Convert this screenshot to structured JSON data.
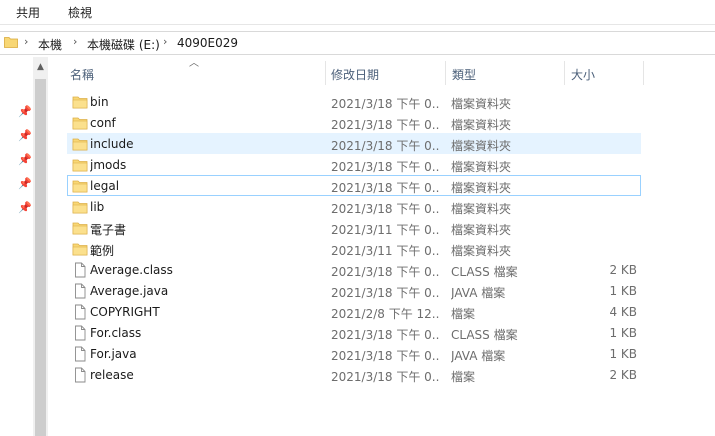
{
  "ribbon": {
    "tabs": [
      "共用",
      "檢視"
    ]
  },
  "address": {
    "crumbs": [
      "本機",
      "本機磁碟 (E:)",
      "4090E029"
    ]
  },
  "columns": {
    "name": "名稱",
    "date": "修改日期",
    "type": "類型",
    "size": "大小"
  },
  "files": [
    {
      "name": "bin",
      "date": "2021/3/18 下午 0...",
      "type": "檔案資料夾",
      "size": "",
      "icon": "folder-icon"
    },
    {
      "name": "conf",
      "date": "2021/3/18 下午 0...",
      "type": "檔案資料夾",
      "size": "",
      "icon": "folder-icon"
    },
    {
      "name": "include",
      "date": "2021/3/18 下午 0...",
      "type": "檔案資料夾",
      "size": "",
      "icon": "folder-icon"
    },
    {
      "name": "jmods",
      "date": "2021/3/18 下午 0...",
      "type": "檔案資料夾",
      "size": "",
      "icon": "folder-icon"
    },
    {
      "name": "legal",
      "date": "2021/3/18 下午 0...",
      "type": "檔案資料夾",
      "size": "",
      "icon": "folder-icon"
    },
    {
      "name": "lib",
      "date": "2021/3/18 下午 0...",
      "type": "檔案資料夾",
      "size": "",
      "icon": "folder-icon"
    },
    {
      "name": "電子書",
      "date": "2021/3/11 下午 0...",
      "type": "檔案資料夾",
      "size": "",
      "icon": "folder-icon"
    },
    {
      "name": "範例",
      "date": "2021/3/11 下午 0...",
      "type": "檔案資料夾",
      "size": "",
      "icon": "folder-icon"
    },
    {
      "name": "Average.class",
      "date": "2021/3/18 下午 0...",
      "type": "CLASS 檔案",
      "size": "2 KB",
      "icon": "file-icon"
    },
    {
      "name": "Average.java",
      "date": "2021/3/18 下午 0...",
      "type": "JAVA 檔案",
      "size": "1 KB",
      "icon": "file-icon"
    },
    {
      "name": "COPYRIGHT",
      "date": "2021/2/8 下午 12...",
      "type": "檔案",
      "size": "4 KB",
      "icon": "file-icon"
    },
    {
      "name": "For.class",
      "date": "2021/3/18 下午 0...",
      "type": "CLASS 檔案",
      "size": "1 KB",
      "icon": "file-icon"
    },
    {
      "name": "For.java",
      "date": "2021/3/18 下午 0...",
      "type": "JAVA 檔案",
      "size": "1 KB",
      "icon": "file-icon"
    },
    {
      "name": "release",
      "date": "2021/3/18 下午 0...",
      "type": "檔案",
      "size": "2 KB",
      "icon": "file-icon"
    }
  ],
  "colors": {
    "selection": "#e5f3ff",
    "focus_border": "#99d1ff",
    "folder": "#f8d775"
  }
}
